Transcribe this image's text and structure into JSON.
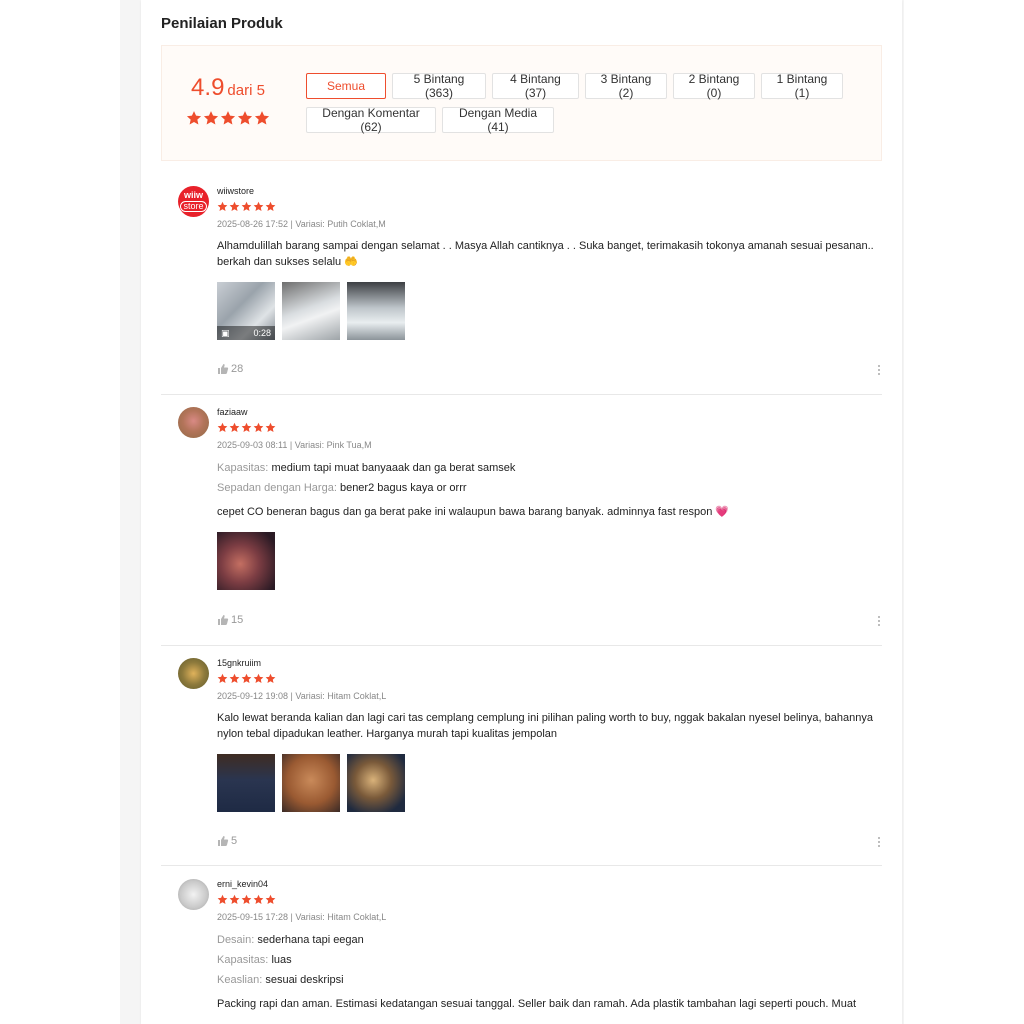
{
  "section_title": "Penilaian Produk",
  "overview": {
    "score": "4.9",
    "score_suffix": "dari 5",
    "rating_value": 4.9,
    "accent": "#ee4d2d",
    "filters": [
      {
        "label": "Semua",
        "active": true
      },
      {
        "label": "5 Bintang (363)",
        "active": false
      },
      {
        "label": "4 Bintang (37)",
        "active": false
      },
      {
        "label": "3 Bintang (2)",
        "active": false
      },
      {
        "label": "2 Bintang (0)",
        "active": false
      },
      {
        "label": "1 Bintang (1)",
        "active": false
      },
      {
        "label": "Dengan Komentar (62)",
        "active": false
      },
      {
        "label": "Dengan Media (41)",
        "active": false
      }
    ]
  },
  "reviews": [
    {
      "username": "wiiwstore",
      "avatar_text": [
        "wiiw",
        "store"
      ],
      "stars": 5,
      "meta": "2025-08-26 17:52 | Variasi: Putih Coklat,M",
      "comment": "Alhamdulillah barang sampai dengan selamat . . Masya Allah cantiknya . . Suka banget, terimakasih tokonya amanah sesuai pesanan.. berkah dan sukses selalu 🤲",
      "video_duration": "0:28",
      "likes": "28"
    },
    {
      "username": "faziaaw",
      "stars": 5,
      "meta": "2025-09-03 08:11 | Variasi: Pink Tua,M",
      "attrs": [
        {
          "k": "Kapasitas:",
          "v": "medium tapi muat banyaaak dan ga berat samsek"
        },
        {
          "k": "Sepadan dengan Harga:",
          "v": "bener2 bagus kaya or orrr"
        }
      ],
      "comment": "cepet CO beneran bagus dan ga berat pake ini walaupun bawa barang banyak. adminnya fast respon 💗",
      "likes": "15"
    },
    {
      "username": "15gnkruiim",
      "stars": 5,
      "meta": "2025-09-12 19:08 | Variasi: Hitam Coklat,L",
      "comment": "Kalo lewat beranda kalian dan lagi cari tas cemplang cemplung ini pilihan paling worth to buy, nggak bakalan nyesel belinya, bahannya nylon tebal dipadukan leather. Harganya murah tapi kualitas jempolan",
      "likes": "5"
    },
    {
      "username": "erni_kevin04",
      "stars": 5,
      "meta": "2025-09-15 17:28 | Variasi: Hitam Coklat,L",
      "attrs": [
        {
          "k": "Desain:",
          "v": "sederhana tapi eegan"
        },
        {
          "k": "Kapasitas:",
          "v": "luas"
        },
        {
          "k": "Keaslian:",
          "v": "sesuai deskripsi"
        }
      ],
      "comment": "Packing rapi dan aman. Estimasi kedatangan sesuai tanggal. Seller baik dan ramah. Ada plastik tambahan lagi seperti pouch. Muat"
    }
  ]
}
